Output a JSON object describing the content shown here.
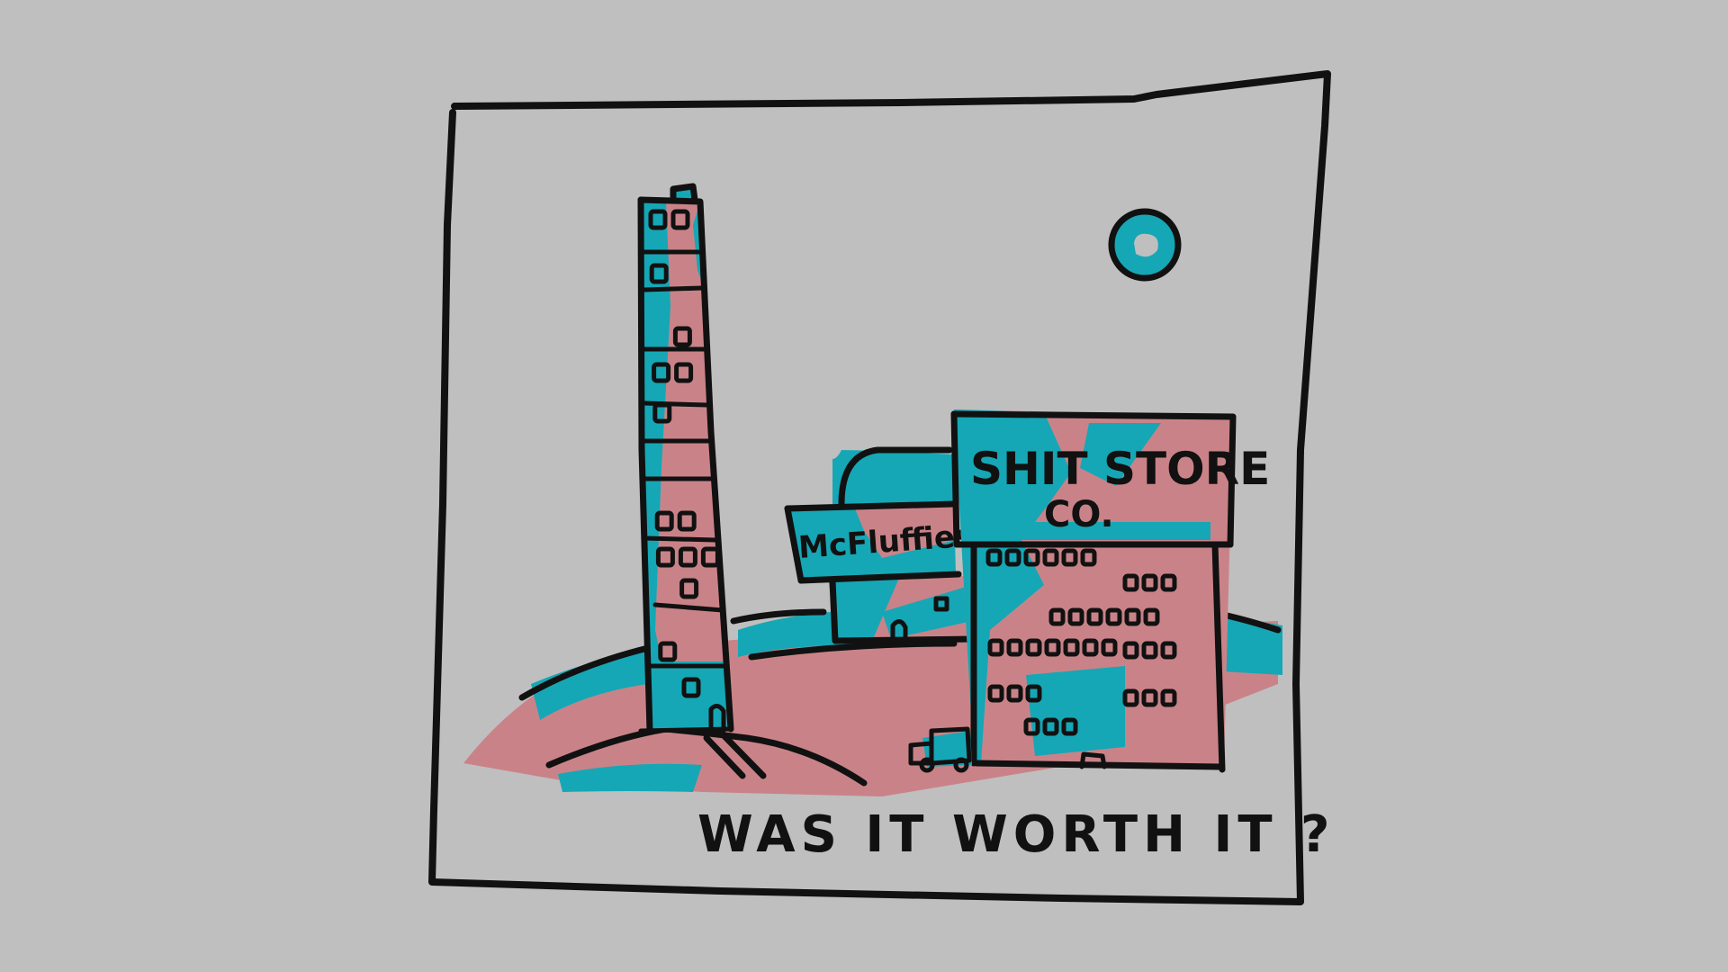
{
  "colors": {
    "background": "#bfbfbf",
    "ink": "#111111",
    "teal": "#15a7b5",
    "pink": "#c98388"
  },
  "illustration": {
    "tower_windows": [
      {
        "col": 0,
        "row": 0
      },
      {
        "col": 1,
        "row": 0
      },
      {
        "col": 0,
        "row": 1
      },
      {
        "col": 1,
        "row": 2
      },
      {
        "col": 0,
        "row": 3
      },
      {
        "col": 1,
        "row": 3
      },
      {
        "col": 0,
        "row": 4
      },
      {
        "col": 0,
        "row": 6
      },
      {
        "col": 1,
        "row": 6
      },
      {
        "col": 0,
        "row": 7
      },
      {
        "col": 1,
        "row": 7
      },
      {
        "col": 2,
        "row": 7
      },
      {
        "col": 1,
        "row": 8
      },
      {
        "col": 0,
        "row": 9
      },
      {
        "col": 1,
        "row": 10
      }
    ],
    "store_window_rows": [
      6,
      3,
      6,
      7,
      3,
      3,
      3,
      3
    ],
    "mcfluffies_sign": "McFluffies",
    "store_sign_line1": "SHIT STORE",
    "store_sign_line2": "CO.",
    "caption": "WAS IT WORTH IT ?"
  }
}
